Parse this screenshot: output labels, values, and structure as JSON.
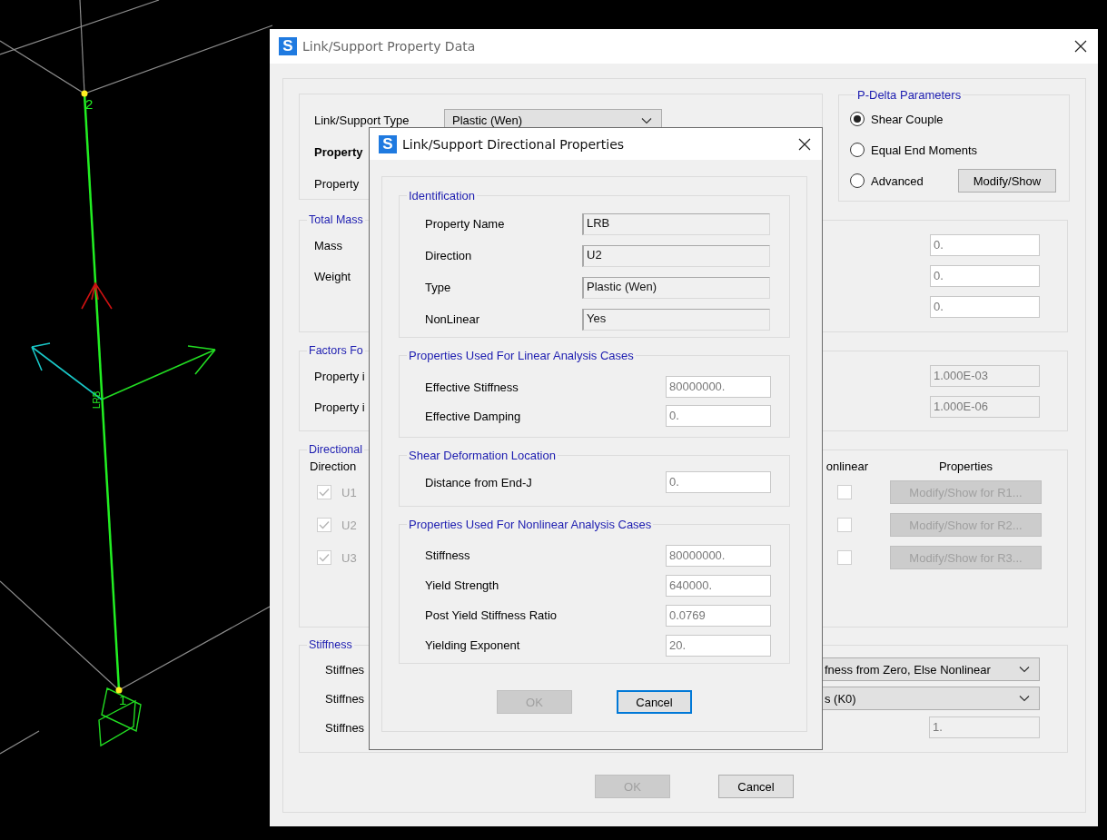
{
  "model_view": {
    "joint_labels": [
      "2",
      "1"
    ],
    "link_label": "LRB"
  },
  "property_dialog": {
    "icon_letter": "S",
    "title": "Link/Support Property Data",
    "type_label": "Link/Support Type",
    "type_value": "Plastic (Wen)",
    "property_heading": "Property",
    "property_name_label": "Property",
    "pdelta": {
      "title": "P-Delta Parameters",
      "options": [
        {
          "label": "Shear Couple",
          "selected": true
        },
        {
          "label": "Equal End Moments",
          "selected": false
        },
        {
          "label": "Advanced",
          "selected": false
        }
      ],
      "button": "Modify/Show"
    },
    "total_mass": {
      "title": "Total Mass",
      "rows": [
        {
          "label": "Mass",
          "value": "0.",
          "disabled": false
        },
        {
          "label": "Weight",
          "value": "0.",
          "disabled": false
        },
        {
          "value": "0.",
          "disabled": false
        }
      ]
    },
    "factors": {
      "title": "Factors Fo",
      "rows": [
        {
          "label": "Property i",
          "value": "1.000E-03",
          "disabled": true
        },
        {
          "label": "Property i",
          "value": "1.000E-06",
          "disabled": true
        }
      ]
    },
    "directional": {
      "title": "Directional",
      "columns": [
        "Direction",
        "onlinear",
        "Properties"
      ],
      "rows": [
        {
          "direction": "U1",
          "checked": true,
          "disabled": true,
          "nonlinear": false,
          "button": "Modify/Show for R1...",
          "button_disabled": true
        },
        {
          "direction": "U2",
          "checked": true,
          "disabled": true,
          "nonlinear": false,
          "button": "Modify/Show for R2...",
          "button_disabled": true
        },
        {
          "direction": "U3",
          "checked": true,
          "disabled": true,
          "nonlinear": false,
          "button": "Modify/Show for R3...",
          "button_disabled": true
        }
      ]
    },
    "stiffness": {
      "title": "Stiffness",
      "rows": [
        {
          "kind": "combo",
          "label": "Stiffnes",
          "value": "fness from Zero, Else Nonlinear"
        },
        {
          "kind": "combo",
          "label": "Stiffnes",
          "value": "s (K0)"
        },
        {
          "kind": "field",
          "label": "Stiffnes",
          "value": "1.",
          "disabled": true
        }
      ]
    },
    "buttons": [
      {
        "label": "OK",
        "disabled": true
      },
      {
        "label": "Cancel",
        "disabled": false
      }
    ]
  },
  "directional_dialog": {
    "icon_letter": "S",
    "title": "Link/Support Directional Properties",
    "sections": [
      {
        "title": "Identification",
        "rows": [
          {
            "label": "Property Name",
            "value": "LRB",
            "kind": "readonly"
          },
          {
            "label": "Direction",
            "value": "U2",
            "kind": "readonly"
          },
          {
            "label": "Type",
            "value": "Plastic (Wen)",
            "kind": "readonly"
          },
          {
            "label": "NonLinear",
            "value": "Yes",
            "kind": "readonly"
          }
        ]
      },
      {
        "title": "Properties Used For Linear Analysis Cases",
        "rows": [
          {
            "label": "Effective Stiffness",
            "value": "80000000.",
            "kind": "input"
          },
          {
            "label": "Effective Damping",
            "value": "0.",
            "kind": "input"
          }
        ]
      },
      {
        "title": "Shear Deformation Location",
        "rows": [
          {
            "label": "Distance from End-J",
            "value": "0.",
            "kind": "input"
          }
        ]
      },
      {
        "title": "Properties Used For Nonlinear Analysis Cases",
        "rows": [
          {
            "label": "Stiffness",
            "value": "80000000.",
            "kind": "input"
          },
          {
            "label": "Yield Strength",
            "value": "640000.",
            "kind": "input"
          },
          {
            "label": "Post Yield Stiffness Ratio",
            "value": "0.0769",
            "kind": "input"
          },
          {
            "label": "Yielding Exponent",
            "value": "20.",
            "kind": "input"
          }
        ]
      }
    ],
    "buttons": [
      {
        "label": "OK",
        "disabled": true,
        "focused": false
      },
      {
        "label": "Cancel",
        "disabled": false,
        "focused": true
      }
    ]
  }
}
